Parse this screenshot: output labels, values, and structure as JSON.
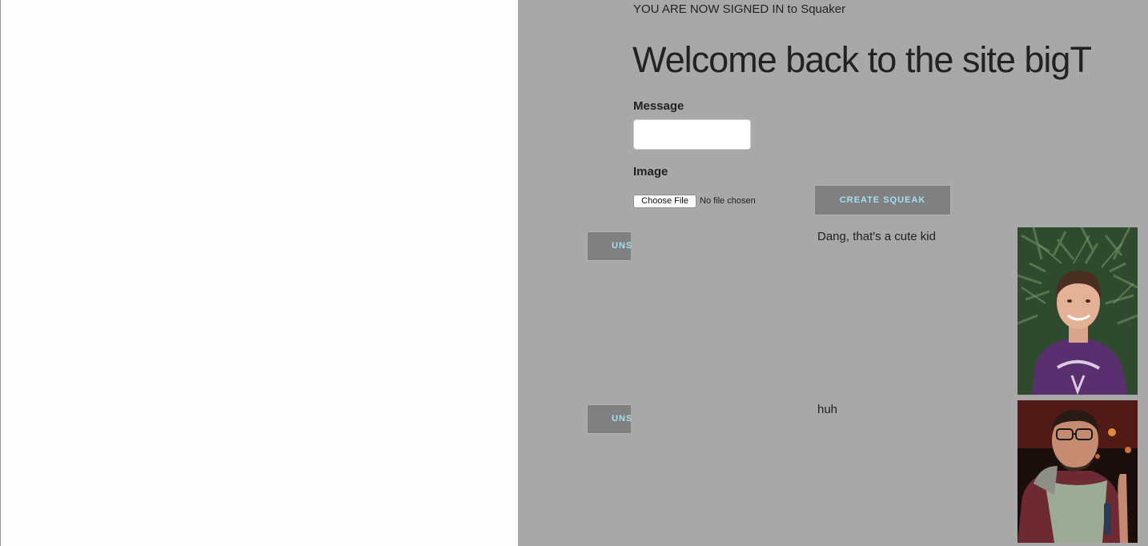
{
  "header": {
    "signed_in_text": "YOU ARE NOW SIGNED IN to Squaker",
    "welcome_title": "Welcome back to the site bigT"
  },
  "form": {
    "message_label": "Message",
    "message_value": "",
    "image_label": "Image",
    "choose_file_label": "Choose File",
    "file_status": "No file chosen",
    "submit_label": "CREATE SQUEAK"
  },
  "squeaks": [
    {
      "unsubscribe_label": "UNSUBSCRIBE",
      "text": "Dang, that's a cute kid",
      "image_icon": "photo-boy-purple-shirt-icon"
    },
    {
      "unsubscribe_label": "UNSUBSCRIBE",
      "text": "huh",
      "image_icon": "photo-man-glasses-icon"
    }
  ],
  "colors": {
    "page_background": "#fefefe",
    "panel_background": "#a8a8a8",
    "button_background": "#808080",
    "button_text": "#a7dff2"
  }
}
